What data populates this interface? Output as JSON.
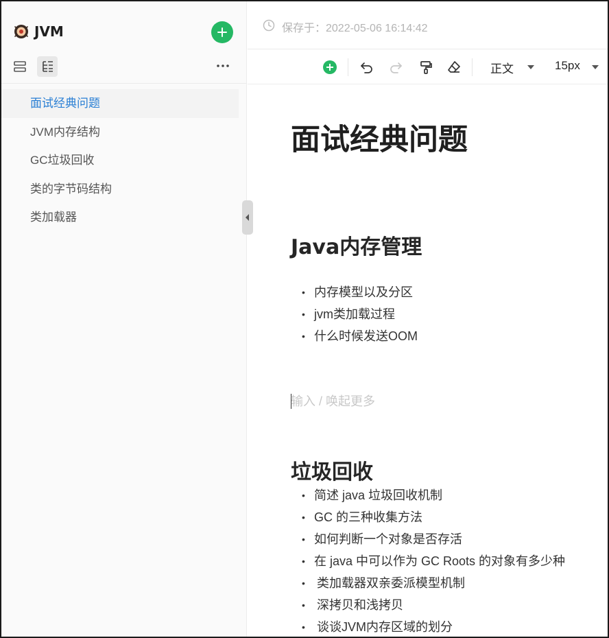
{
  "sidebar": {
    "app_title": "JVM",
    "logo_icon": "spider-logo-icon",
    "items": [
      {
        "label": "面试经典问题",
        "active": true
      },
      {
        "label": "JVM内存结构",
        "active": false
      },
      {
        "label": "GC垃圾回收",
        "active": false
      },
      {
        "label": "类的字节码结构",
        "active": false
      },
      {
        "label": "类加载器",
        "active": false
      }
    ]
  },
  "header": {
    "save_status": "保存于：2022-05-06 16:14:42"
  },
  "toolbar": {
    "style_select": "正文",
    "size_select": "15px",
    "icons": [
      "insert-plus-icon",
      "undo-icon",
      "redo-icon",
      "format-painter-icon",
      "eraser-icon"
    ]
  },
  "document": {
    "title": "面试经典问题",
    "sections": [
      {
        "heading": "Java内存管理",
        "items": [
          "内存模型以及分区",
          "jvm类加载过程",
          "什么时候发送OOM"
        ]
      },
      {
        "heading": "垃圾回收",
        "items": [
          "简述 java 垃圾回收机制",
          "GC 的三种收集方法",
          "如何判断一个对象是否存活",
          "在 java 中可以作为 GC Roots 的对象有多少种",
          "类加载器双亲委派模型机制",
          "深拷贝和浅拷贝",
          "谈谈JVM内存区域的划分"
        ]
      }
    ],
    "placeholder": "输入 / 唤起更多"
  },
  "colors": {
    "accent_green": "#25b864",
    "active_blue": "#2a7fd4"
  }
}
